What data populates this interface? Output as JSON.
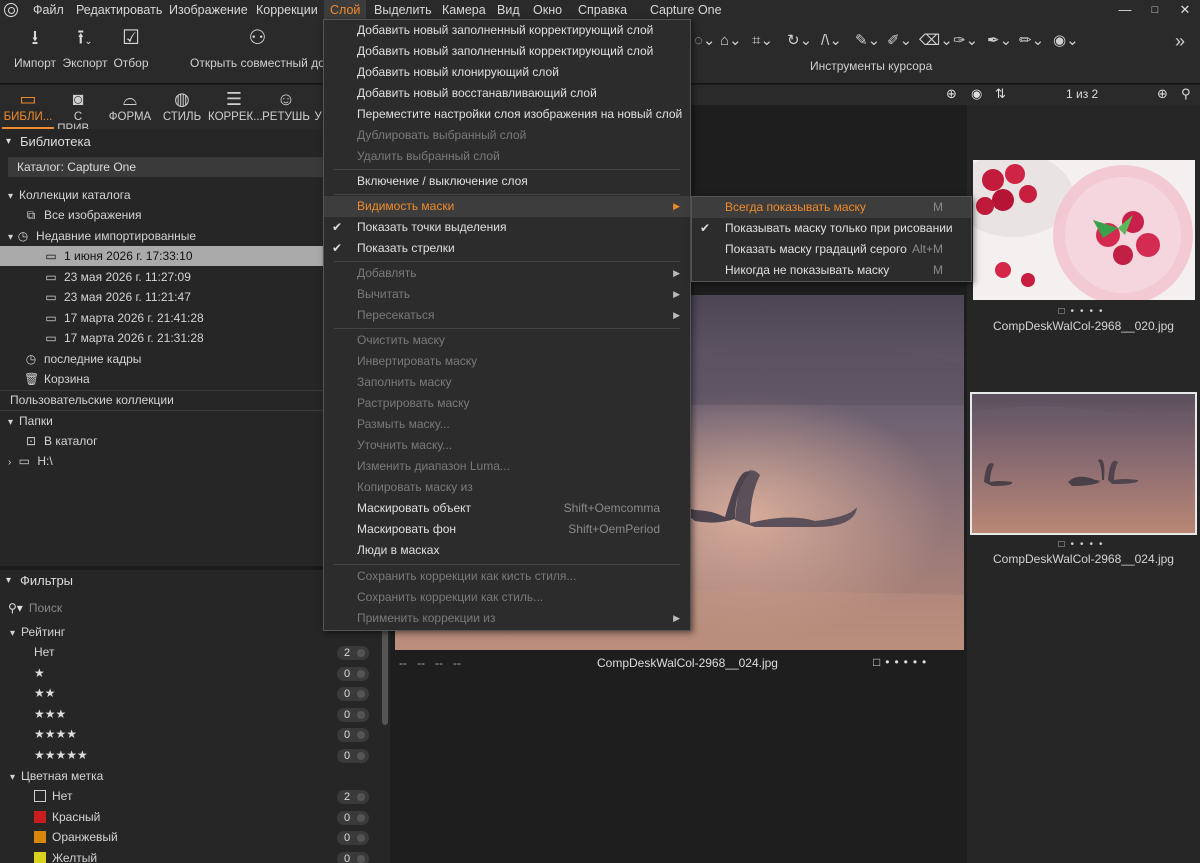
{
  "menubar": {
    "items": [
      "Файл",
      "Редактировать",
      "Изображение",
      "Коррекции",
      "Слой",
      "Выделить",
      "Камера",
      "Вид",
      "Окно",
      "Справка",
      "Capture One"
    ],
    "active": "Слой",
    "minimize": "—",
    "maximize": "□",
    "close": "✕"
  },
  "toolbar": {
    "import": "Импорт",
    "export": "Экспорт",
    "select": "Отбор",
    "shared": "Открыть совместный дост",
    "cursor_tools": "Инструменты курсора"
  },
  "tabs": [
    "БИБЛИ...",
    "С ПРИВ...",
    "ФОРМА",
    "СТИЛЬ",
    "КОРРЕК...",
    "РЕТУШЬ",
    "У"
  ],
  "library": {
    "title": "Библиотека",
    "catalog": "Каталог: Capture One",
    "catalog_collections": "Коллекции каталога",
    "all_images": "Все изображения",
    "recent_imports": "Недавние импортированные",
    "imports": [
      "1 июня 2026 г. 17:33:10",
      "23 мая 2026 г. 11:27:09",
      "23 мая 2026 г. 11:21:47",
      "17 марта 2026 г. 21:41:28",
      "17 марта 2026 г. 21:31:28"
    ],
    "recent_captures": "последние кадры",
    "trash": "Корзина",
    "user_collections": "Пользовательские коллекции",
    "folders": "Папки",
    "in_catalog": "В каталог",
    "drive": "H:\\"
  },
  "filters": {
    "title": "Фильтры",
    "search_placeholder": "Поиск",
    "rating": "Рейтинг",
    "rating_rows": [
      {
        "label": "Нет",
        "count": "2"
      },
      {
        "label": "★",
        "count": "0"
      },
      {
        "label": "★★",
        "count": "0"
      },
      {
        "label": "★★★",
        "count": "0"
      },
      {
        "label": "★★★★",
        "count": "0"
      },
      {
        "label": "★★★★★",
        "count": "0"
      }
    ],
    "color_label": "Цветная метка",
    "colors": [
      {
        "label": "Нет",
        "count": "2",
        "color": "none"
      },
      {
        "label": "Красный",
        "count": "0",
        "color": "#c81e1e"
      },
      {
        "label": "Оранжевый",
        "count": "0",
        "color": "#d9860f"
      },
      {
        "label": "Желтый",
        "count": "0",
        "color": "#d8d21e"
      }
    ]
  },
  "viewer": {
    "caption": "CompDeskWalCol-2968__024.jpg",
    "meta": "--   --   --   --"
  },
  "browser": {
    "count": "1 из 2",
    "thumbs": [
      "CompDeskWalCol-2968__020.jpg",
      "CompDeskWalCol-2968__024.jpg"
    ]
  },
  "layer_menu": {
    "items": [
      {
        "label": "Добавить новый заполненный корректирующий слой",
        "enabled": true
      },
      {
        "label": "Добавить новый заполненный корректирующий слой",
        "enabled": true
      },
      {
        "label": "Добавить новый клонирующий слой",
        "enabled": true
      },
      {
        "label": "Добавить новый восстанавливающий слой",
        "enabled": true
      },
      {
        "label": "Переместите настройки слоя изображения на новый слой",
        "enabled": true
      },
      {
        "label": "Дублировать выбранный слой",
        "enabled": false
      },
      {
        "label": "Удалить выбранный слой",
        "enabled": false
      },
      {
        "label": "Включение / выключение слоя",
        "enabled": true
      },
      {
        "label": "Видимость маски",
        "enabled": true,
        "submenu": true,
        "highlight": true
      },
      {
        "label": "Показать точки выделения",
        "enabled": true,
        "checked": true
      },
      {
        "label": "Показать стрелки",
        "enabled": true,
        "checked": true
      },
      {
        "label": "Добавлять",
        "enabled": false,
        "submenu": true
      },
      {
        "label": "Вычитать",
        "enabled": false,
        "submenu": true
      },
      {
        "label": "Пересекаться",
        "enabled": false,
        "submenu": true
      },
      {
        "label": "Очистить маску",
        "enabled": false
      },
      {
        "label": "Инвертировать маску",
        "enabled": false
      },
      {
        "label": "Заполнить маску",
        "enabled": false
      },
      {
        "label": "Растрировать маску",
        "enabled": false
      },
      {
        "label": "Размыть маску...",
        "enabled": false
      },
      {
        "label": "Уточнить маску...",
        "enabled": false
      },
      {
        "label": "Изменить диапазон Luma...",
        "enabled": false
      },
      {
        "label": "Копировать маску из",
        "enabled": false
      },
      {
        "label": "Маскировать объект",
        "enabled": true,
        "shortcut": "Shift+Oemcomma"
      },
      {
        "label": "Маскировать фон",
        "enabled": true,
        "shortcut": "Shift+OemPeriod"
      },
      {
        "label": "Люди в масках",
        "enabled": true
      },
      {
        "label": "Сохранить коррекции как кисть стиля...",
        "enabled": false
      },
      {
        "label": "Сохранить коррекции как стиль...",
        "enabled": false
      },
      {
        "label": "Применить коррекции из",
        "enabled": false,
        "submenu": true
      }
    ]
  },
  "mask_submenu": {
    "items": [
      {
        "label": "Всегда показывать маску",
        "shortcut": "M",
        "highlight": true
      },
      {
        "label": "Показывать маску только при рисовании",
        "checked": true
      },
      {
        "label": "Показать маску градаций серого",
        "shortcut": "Alt+M"
      },
      {
        "label": "Никогда не показывать маску",
        "shortcut": "M"
      }
    ]
  },
  "colors": {
    "accent": "#f08b2c",
    "menu_bg": "#2c2c2c",
    "panel_bg": "#262626"
  }
}
